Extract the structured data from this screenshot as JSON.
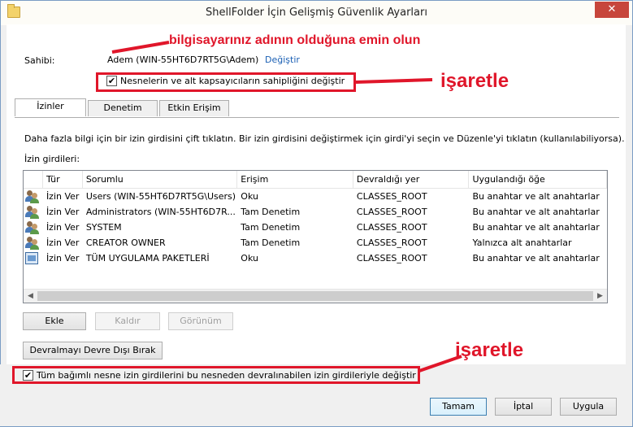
{
  "window": {
    "title": "ShellFolder İçin Gelişmiş Güvenlik Ayarları",
    "close_label": "✕"
  },
  "annotations": {
    "owner_note": "bilgisayarınız adının olduğuna emin olun",
    "check_note_1": "işaretle",
    "check_note_2": "işaretle",
    "color": "#e0162a"
  },
  "owner": {
    "label": "Sahibi:",
    "value": "Adem (WIN-55HT6D7RT5G\\Adem)",
    "change_link": "Değiştir"
  },
  "replace_owner_checkbox": {
    "label": "Nesnelerin ve alt kapsayıcıların sahipliğini değiştir",
    "checked": true
  },
  "tabs": [
    {
      "label": "İzinler",
      "active": true
    },
    {
      "label": "Denetim",
      "active": false
    },
    {
      "label": "Etkin Erişim",
      "active": false
    }
  ],
  "permissions": {
    "info_text": "Daha fazla bilgi için bir izin girdisini çift tıklatın. Bir izin girdisini değiştirmek için girdi'yi seçin ve Düzenle'yi tıklatın (kullanılabiliyorsa).",
    "entries_label": "İzin girdileri:",
    "columns": [
      "Tür",
      "Sorumlu",
      "Erişim",
      "Devraldığı yer",
      "Uygulandığı öğe"
    ],
    "rows": [
      {
        "icon": "users-icon",
        "type": "İzin Ver",
        "principal": "Users (WIN-55HT6D7RT5G\\Users)",
        "access": "Oku",
        "inherited_from": "CLASSES_ROOT",
        "applies_to": "Bu anahtar ve alt anahtarlar"
      },
      {
        "icon": "users-icon",
        "type": "İzin Ver",
        "principal": "Administrators (WIN-55HT6D7R...",
        "access": "Tam Denetim",
        "inherited_from": "CLASSES_ROOT",
        "applies_to": "Bu anahtar ve alt anahtarlar"
      },
      {
        "icon": "users-icon",
        "type": "İzin Ver",
        "principal": "SYSTEM",
        "access": "Tam Denetim",
        "inherited_from": "CLASSES_ROOT",
        "applies_to": "Bu anahtar ve alt anahtarlar"
      },
      {
        "icon": "users-icon",
        "type": "İzin Ver",
        "principal": "CREATOR OWNER",
        "access": "Tam Denetim",
        "inherited_from": "CLASSES_ROOT",
        "applies_to": "Yalnızca alt anahtarlar"
      },
      {
        "icon": "package-icon",
        "type": "İzin Ver",
        "principal": "TÜM UYGULAMA PAKETLERİ",
        "access": "Oku",
        "inherited_from": "CLASSES_ROOT",
        "applies_to": "Bu anahtar ve alt anahtarlar"
      }
    ],
    "add_label": "Ekle",
    "remove_label": "Kaldır",
    "view_label": "Görünüm",
    "disable_inheritance_label": "Devralmayı Devre Dışı Bırak"
  },
  "replace_child_checkbox": {
    "label": "Tüm bağımlı nesne izin girdilerini bu nesneden devralınabilen izin girdileriyle değiştir",
    "checked": true
  },
  "footer": {
    "ok_label": "Tamam",
    "cancel_label": "İptal",
    "apply_label": "Uygula"
  }
}
